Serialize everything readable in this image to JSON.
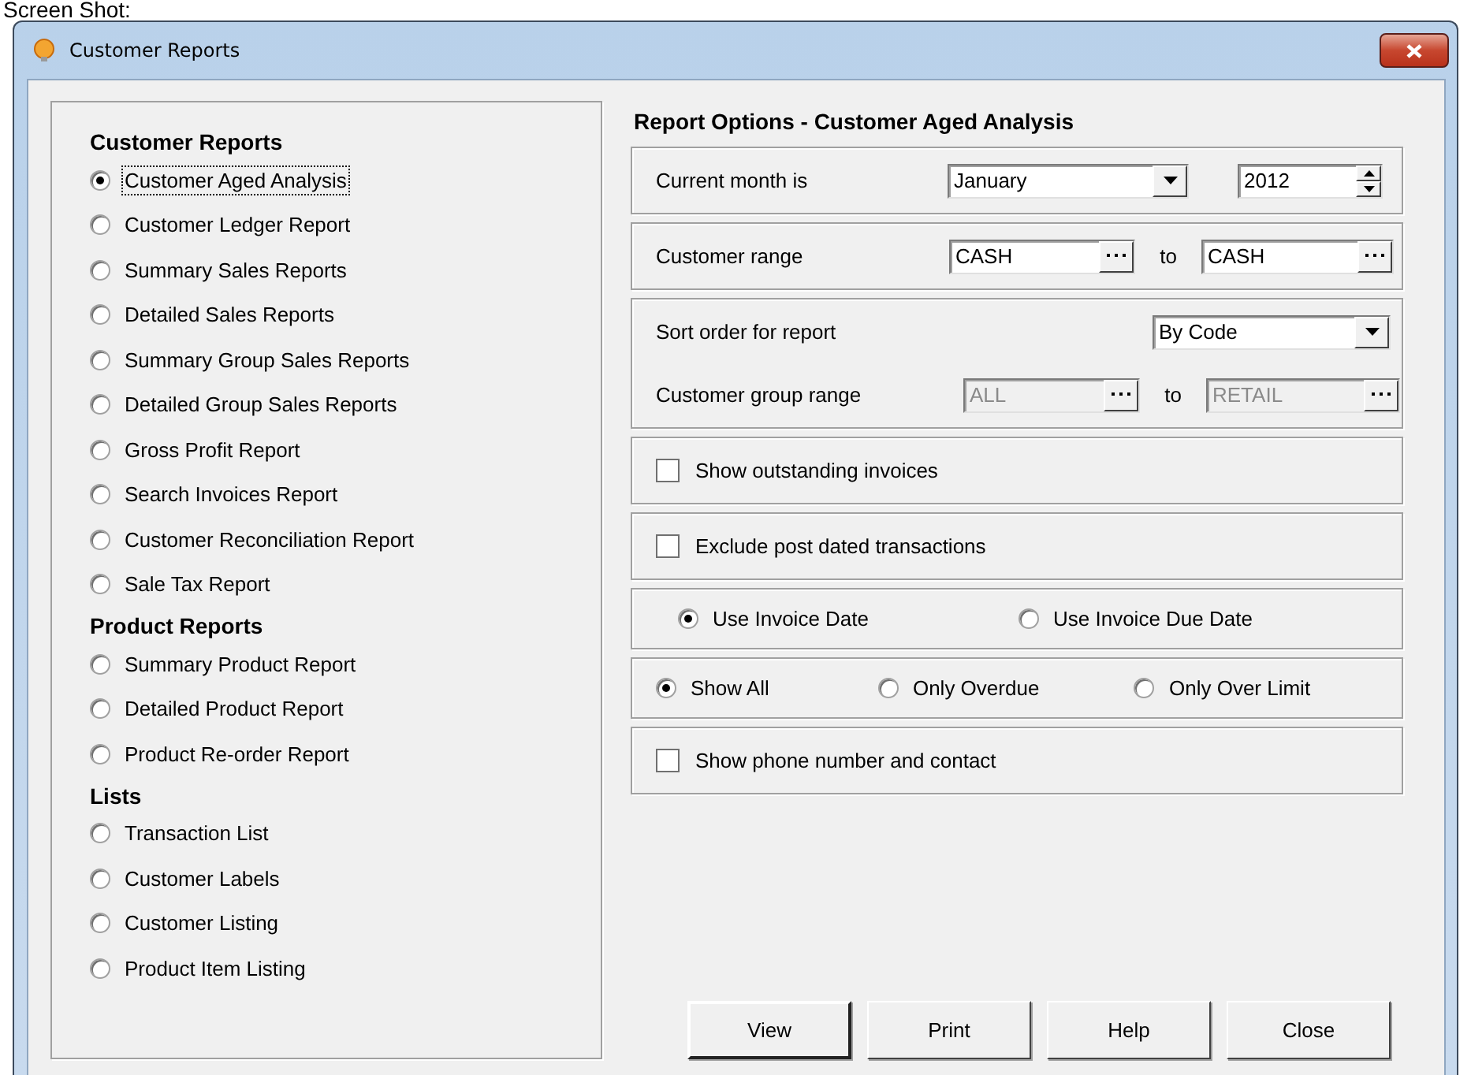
{
  "caption": "Screen Shot:",
  "window": {
    "title": "Customer Reports"
  },
  "report_list": {
    "groups": [
      {
        "heading": "Customer Reports",
        "items": [
          {
            "label": "Customer Aged Analysis",
            "selected": true
          },
          {
            "label": "Customer Ledger Report",
            "selected": false
          },
          {
            "label": "Summary Sales Reports",
            "selected": false
          },
          {
            "label": "Detailed Sales Reports",
            "selected": false
          },
          {
            "label": "Summary Group Sales Reports",
            "selected": false
          },
          {
            "label": "Detailed Group Sales Reports",
            "selected": false
          },
          {
            "label": "Gross Profit Report",
            "selected": false
          },
          {
            "label": "Search Invoices Report",
            "selected": false
          },
          {
            "label": "Customer Reconciliation Report",
            "selected": false
          },
          {
            "label": "Sale Tax Report",
            "selected": false
          }
        ]
      },
      {
        "heading": "Product Reports",
        "items": [
          {
            "label": "Summary Product Report",
            "selected": false
          },
          {
            "label": "Detailed Product Report",
            "selected": false
          },
          {
            "label": "Product Re-order Report",
            "selected": false
          }
        ]
      },
      {
        "heading": "Lists",
        "items": [
          {
            "label": "Transaction List",
            "selected": false
          },
          {
            "label": "Customer Labels",
            "selected": false
          },
          {
            "label": "Customer Listing",
            "selected": false
          },
          {
            "label": "Product Item Listing",
            "selected": false
          }
        ]
      }
    ]
  },
  "options": {
    "title": "Report Options - Customer Aged Analysis",
    "month": {
      "label": "Current month is",
      "value": "January",
      "year": "2012"
    },
    "customer_range": {
      "label": "Customer range",
      "from": "CASH",
      "to_label": "to",
      "to": "CASH",
      "disabled": false
    },
    "sort_order": {
      "label": "Sort order for report",
      "value": "By Code"
    },
    "group_range": {
      "label": "Customer group range",
      "from": "ALL",
      "to_label": "to",
      "to": "RETAIL",
      "disabled": true
    },
    "show_outstanding": {
      "label": "Show outstanding invoices",
      "checked": false
    },
    "exclude_post_dated": {
      "label": "Exclude post dated transactions",
      "checked": false
    },
    "date_basis": [
      {
        "label": "Use Invoice Date",
        "selected": true
      },
      {
        "label": "Use Invoice Due Date",
        "selected": false
      }
    ],
    "filter": [
      {
        "label": "Show All",
        "selected": true
      },
      {
        "label": "Only Overdue",
        "selected": false
      },
      {
        "label": "Only Over Limit",
        "selected": false
      }
    ],
    "show_phone": {
      "label": "Show phone number and contact",
      "checked": false
    }
  },
  "buttons": [
    "View",
    "Print",
    "Help",
    "Close"
  ]
}
